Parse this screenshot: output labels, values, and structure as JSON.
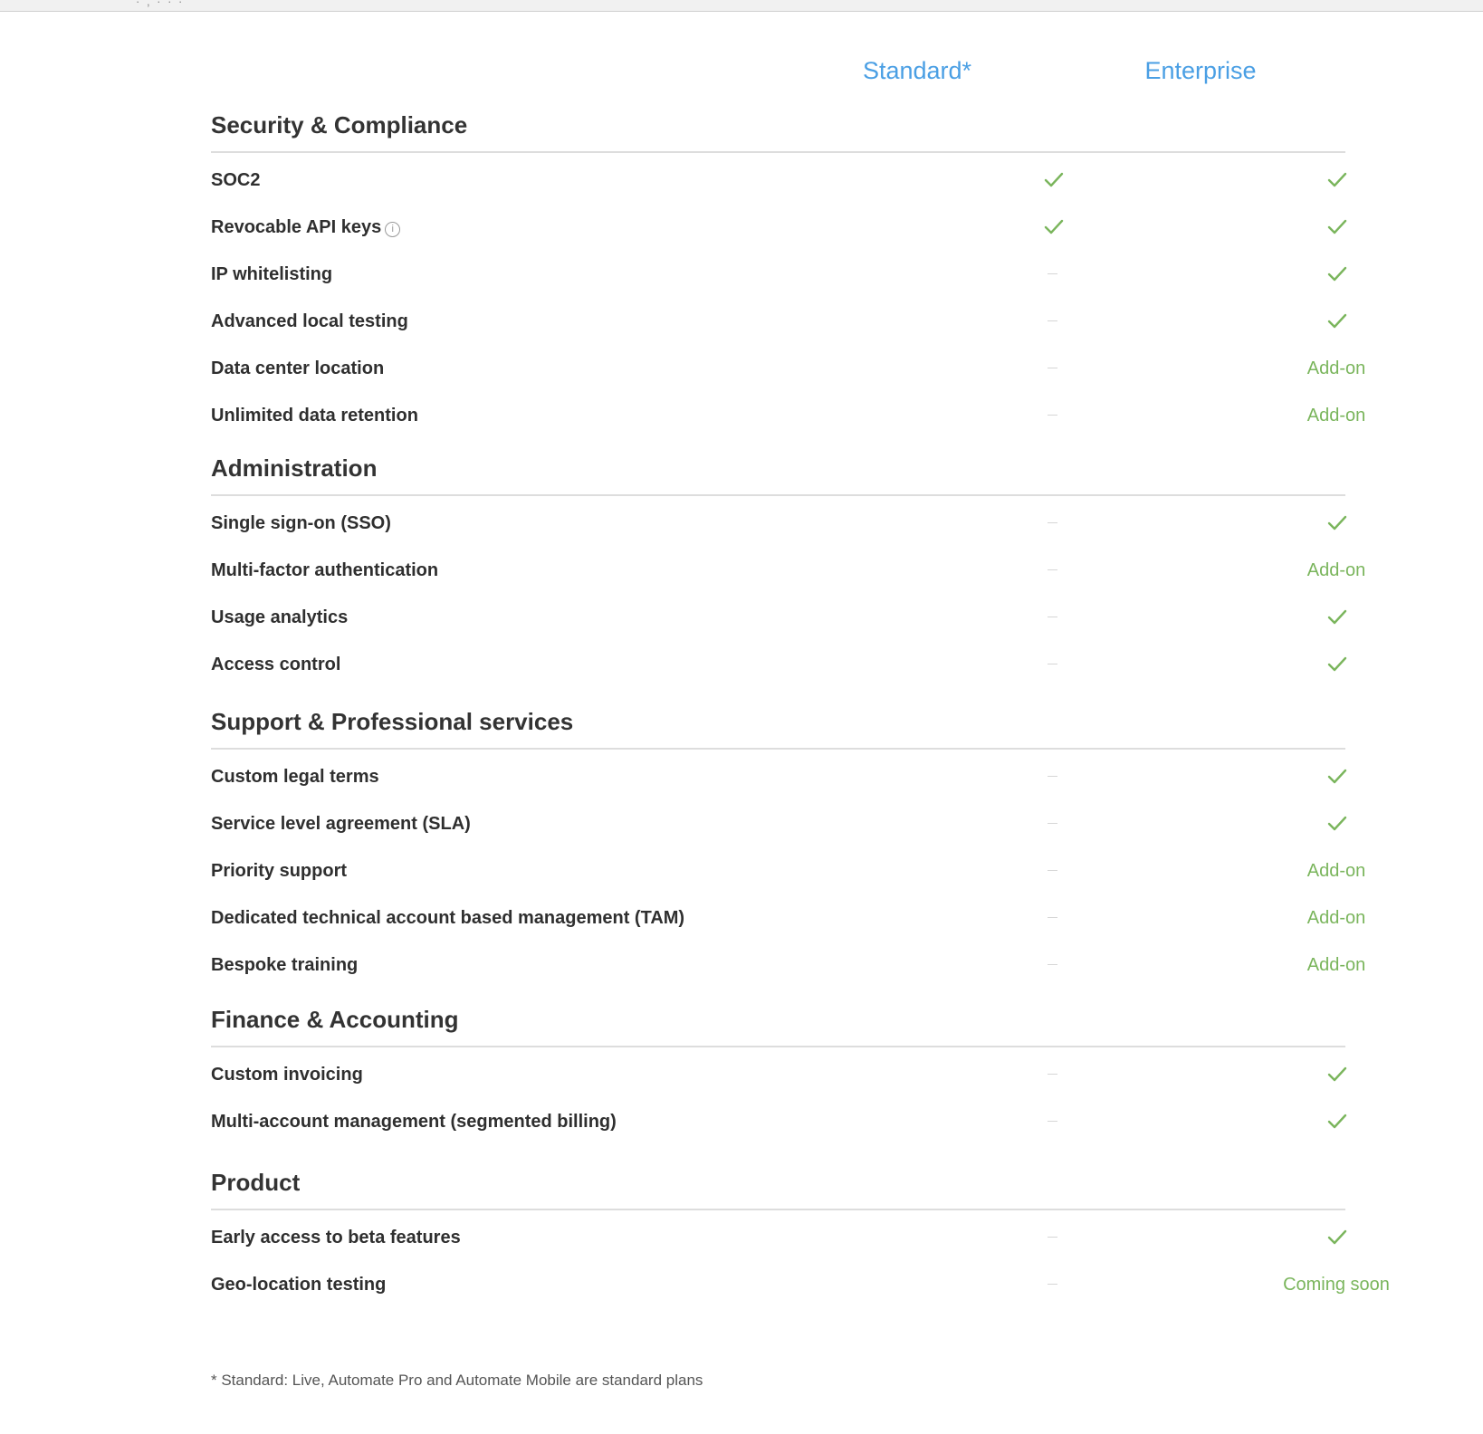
{
  "browser": {
    "top_fragment": "· , · · ·"
  },
  "plans": {
    "standard": "Standard*",
    "enterprise": "Enterprise"
  },
  "colors": {
    "plan_header": "#4a9fe4",
    "check": "#7ab55c",
    "addon_text": "#7ab55c",
    "dash": "#d6d6d6",
    "divider": "#dddddd"
  },
  "sections": [
    {
      "title": "Security & Compliance",
      "rows": [
        {
          "feature": "SOC2",
          "info_icon": false,
          "standard": "check",
          "enterprise": "check"
        },
        {
          "feature": "Revocable API keys",
          "info_icon": true,
          "standard": "check",
          "enterprise": "check"
        },
        {
          "feature": "IP whitelisting",
          "info_icon": false,
          "standard": "dash",
          "enterprise": "check"
        },
        {
          "feature": "Advanced local testing",
          "info_icon": false,
          "standard": "dash",
          "enterprise": "check"
        },
        {
          "feature": "Data center location",
          "info_icon": false,
          "standard": "dash",
          "enterprise": "Add-on"
        },
        {
          "feature": "Unlimited data retention",
          "info_icon": false,
          "standard": "dash",
          "enterprise": "Add-on"
        }
      ]
    },
    {
      "title": "Administration",
      "rows": [
        {
          "feature": "Single sign-on (SSO)",
          "info_icon": false,
          "standard": "dash",
          "enterprise": "check"
        },
        {
          "feature": "Multi-factor authentication",
          "info_icon": false,
          "standard": "dash",
          "enterprise": "Add-on"
        },
        {
          "feature": "Usage analytics",
          "info_icon": false,
          "standard": "dash",
          "enterprise": "check"
        },
        {
          "feature": "Access control",
          "info_icon": false,
          "standard": "dash",
          "enterprise": "check"
        }
      ]
    },
    {
      "title": "Support & Professional services",
      "rows": [
        {
          "feature": "Custom legal terms",
          "info_icon": false,
          "standard": "dash",
          "enterprise": "check"
        },
        {
          "feature": "Service level agreement (SLA)",
          "info_icon": false,
          "standard": "dash",
          "enterprise": "check"
        },
        {
          "feature": "Priority support",
          "info_icon": false,
          "standard": "dash",
          "enterprise": "Add-on"
        },
        {
          "feature": "Dedicated technical account based management (TAM)",
          "info_icon": false,
          "standard": "dash",
          "enterprise": "Add-on"
        },
        {
          "feature": "Bespoke training",
          "info_icon": false,
          "standard": "dash",
          "enterprise": "Add-on"
        }
      ]
    },
    {
      "title": "Finance & Accounting",
      "rows": [
        {
          "feature": "Custom invoicing",
          "info_icon": false,
          "standard": "dash",
          "enterprise": "check"
        },
        {
          "feature": "Multi-account management (segmented billing)",
          "info_icon": false,
          "standard": "dash",
          "enterprise": "check"
        }
      ]
    },
    {
      "title": "Product",
      "rows": [
        {
          "feature": "Early access to beta features",
          "info_icon": false,
          "standard": "dash",
          "enterprise": "check"
        },
        {
          "feature": "Geo-location testing",
          "info_icon": false,
          "standard": "dash",
          "enterprise": "Coming soon"
        }
      ]
    }
  ],
  "footnote": "* Standard: Live, Automate Pro and Automate Mobile are standard plans"
}
